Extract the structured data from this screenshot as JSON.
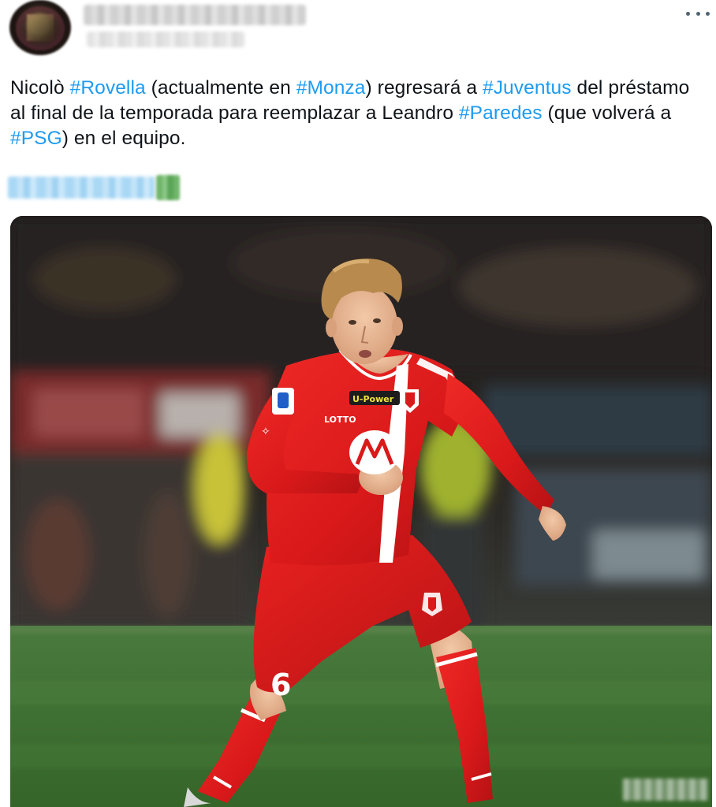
{
  "tweet": {
    "author": {
      "avatar_icon": "user-avatar",
      "name_redacted": true,
      "handle_redacted": true
    },
    "more_icon": "more-horizontal-icon",
    "text_segments": [
      {
        "t": "Nicolò ",
        "tag": false
      },
      {
        "t": "#Rovella",
        "tag": true
      },
      {
        "t": " (actualmente en ",
        "tag": false
      },
      {
        "t": "#Monza",
        "tag": true
      },
      {
        "t": ") regresará a ",
        "tag": false
      },
      {
        "t": "#Juventus",
        "tag": true
      },
      {
        "t": " del préstamo al final de la temporada para reemplazar a Leandro ",
        "tag": false
      },
      {
        "t": "#Paredes",
        "tag": true
      },
      {
        "t": " (que volverá a ",
        "tag": false
      },
      {
        "t": "#PSG",
        "tag": true
      },
      {
        "t": ") en el equipo.",
        "tag": false
      }
    ],
    "translate_redacted": true,
    "media": {
      "description_icon": "football-player-photo",
      "jersey_number": "6",
      "sponsor": "U-Power",
      "kit_brand": "LOTTO"
    },
    "colors": {
      "hashtag": "#1d9bf0",
      "text": "#0f1419",
      "kit_red": "#e0191c"
    }
  }
}
